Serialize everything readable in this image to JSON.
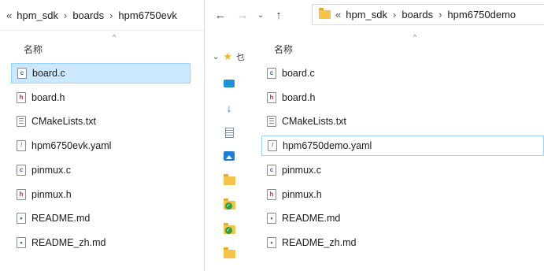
{
  "left": {
    "breadcrumb": {
      "lead": "«",
      "parts": [
        "hpm_sdk",
        "boards",
        "hpm6750evk"
      ],
      "sep": "›"
    },
    "column_name": "名称",
    "sort_caret": "^",
    "files": [
      {
        "name": "board.c",
        "type": "c"
      },
      {
        "name": "board.h",
        "type": "h"
      },
      {
        "name": "CMakeLists.txt",
        "type": "txt"
      },
      {
        "name": "hpm6750evk.yaml",
        "type": "yaml"
      },
      {
        "name": "pinmux.c",
        "type": "c"
      },
      {
        "name": "pinmux.h",
        "type": "h"
      },
      {
        "name": "README.md",
        "type": "md"
      },
      {
        "name": "README_zh.md",
        "type": "md"
      }
    ]
  },
  "right": {
    "nav": {
      "back": "←",
      "forward": "→",
      "recent": "⌄",
      "up": "↑"
    },
    "breadcrumb": {
      "lead": "«",
      "parts": [
        "hpm_sdk",
        "boards",
        "hpm6750demo"
      ],
      "sep": "›"
    },
    "column_name": "名称",
    "sort_caret": "^",
    "quick_access_expand": "⌄",
    "quick_access_label": "乜",
    "files": [
      {
        "name": "board.c",
        "type": "c"
      },
      {
        "name": "board.h",
        "type": "h"
      },
      {
        "name": "CMakeLists.txt",
        "type": "txt"
      },
      {
        "name": "hpm6750demo.yaml",
        "type": "yaml"
      },
      {
        "name": "pinmux.c",
        "type": "c"
      },
      {
        "name": "pinmux.h",
        "type": "h"
      },
      {
        "name": "README.md",
        "type": "md"
      },
      {
        "name": "README_zh.md",
        "type": "md"
      }
    ]
  },
  "icon_glyphs": {
    "c": "c",
    "h": "h",
    "yaml": "!",
    "md": "•"
  },
  "colors": {
    "selection": "#cce8ff",
    "selection_border": "#99d1ff",
    "folder": "#f5c24a"
  }
}
